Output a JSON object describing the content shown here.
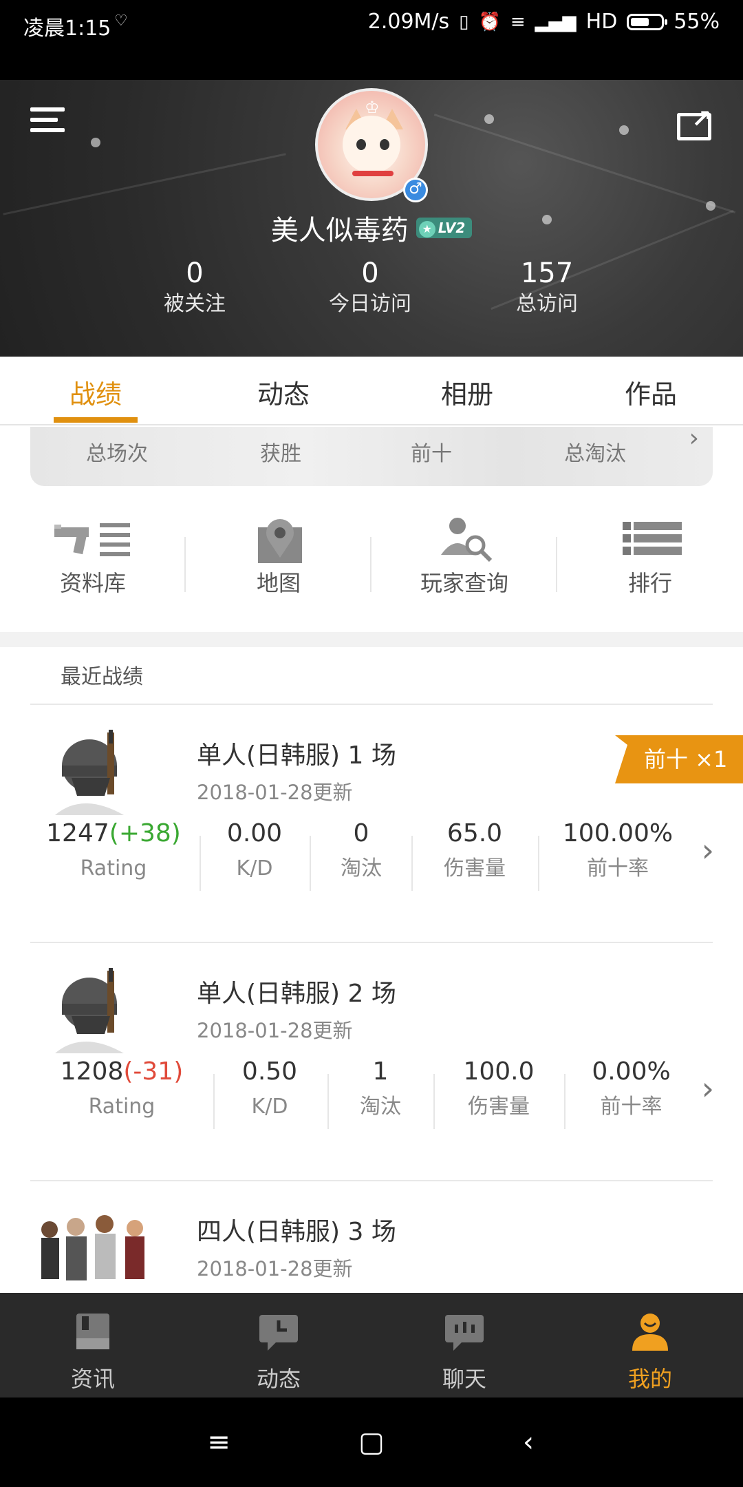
{
  "status_bar": {
    "time": "凌晨1:15",
    "speed": "2.09M/s",
    "network": "HD",
    "battery": "55%"
  },
  "profile": {
    "username": "美人似毒药",
    "level": "LV2",
    "gender_icon": "male-icon",
    "stats": [
      {
        "value": "0",
        "label": "被关注"
      },
      {
        "value": "0",
        "label": "今日访问"
      },
      {
        "value": "157",
        "label": "总访问"
      }
    ]
  },
  "tabs": [
    "战绩",
    "动态",
    "相册",
    "作品"
  ],
  "active_tab": 0,
  "summary": [
    "总场次",
    "获胜",
    "前十",
    "总淘汰"
  ],
  "quick_nav": [
    {
      "label": "资料库",
      "icon": "database-icon"
    },
    {
      "label": "地图",
      "icon": "map-icon"
    },
    {
      "label": "玩家查询",
      "icon": "player-search-icon"
    },
    {
      "label": "排行",
      "icon": "ranking-icon"
    }
  ],
  "recent": {
    "title": "最近战绩",
    "matches": [
      {
        "mode": "单人(日韩服) 1 场",
        "date": "2018-01-28更新",
        "ribbon": "前十 ×1",
        "rating": "1247",
        "rating_delta": "(+38)",
        "rating_label": "Rating",
        "kd": "0.00",
        "kd_label": "K/D",
        "kills": "0",
        "kills_label": "淘汰",
        "damage": "65.0",
        "damage_label": "伤害量",
        "top10": "100.00%",
        "top10_label": "前十率"
      },
      {
        "mode": "单人(日韩服) 2 场",
        "date": "2018-01-28更新",
        "rating": "1208",
        "rating_delta": "(-31)",
        "rating_label": "Rating",
        "kd": "0.50",
        "kd_label": "K/D",
        "kills": "1",
        "kills_label": "淘汰",
        "damage": "100.0",
        "damage_label": "伤害量",
        "top10": "0.00%",
        "top10_label": "前十率"
      },
      {
        "mode": "四人(日韩服) 3 场",
        "date": "2018-01-28更新"
      }
    ]
  },
  "bottom_nav": [
    {
      "label": "资讯",
      "icon": "news-icon"
    },
    {
      "label": "动态",
      "icon": "activity-icon"
    },
    {
      "label": "聊天",
      "icon": "chat-icon"
    },
    {
      "label": "我的",
      "icon": "profile-icon"
    }
  ],
  "colors": {
    "accent": "#e0900f",
    "positive": "#3aa832",
    "negative": "#e04a3a",
    "nav_bg": "#2a2a2a"
  }
}
